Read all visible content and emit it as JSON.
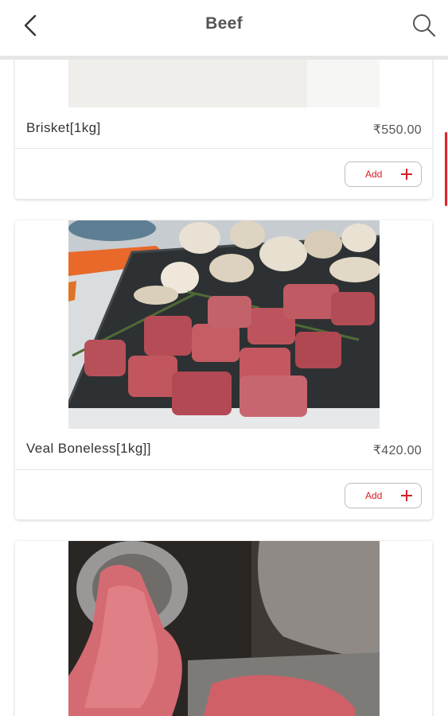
{
  "header": {
    "title": "Beef",
    "back_icon": "chevron-left-icon",
    "search_icon": "search-icon"
  },
  "accent_color": "#d32027",
  "products": [
    {
      "name": "Brisket[1kg]",
      "price": "₹550.00",
      "add_label": "Add"
    },
    {
      "name": "Veal Boneless[1kg]]",
      "price": "₹420.00",
      "add_label": "Add"
    },
    {
      "name": "",
      "price": "",
      "add_label": ""
    }
  ]
}
